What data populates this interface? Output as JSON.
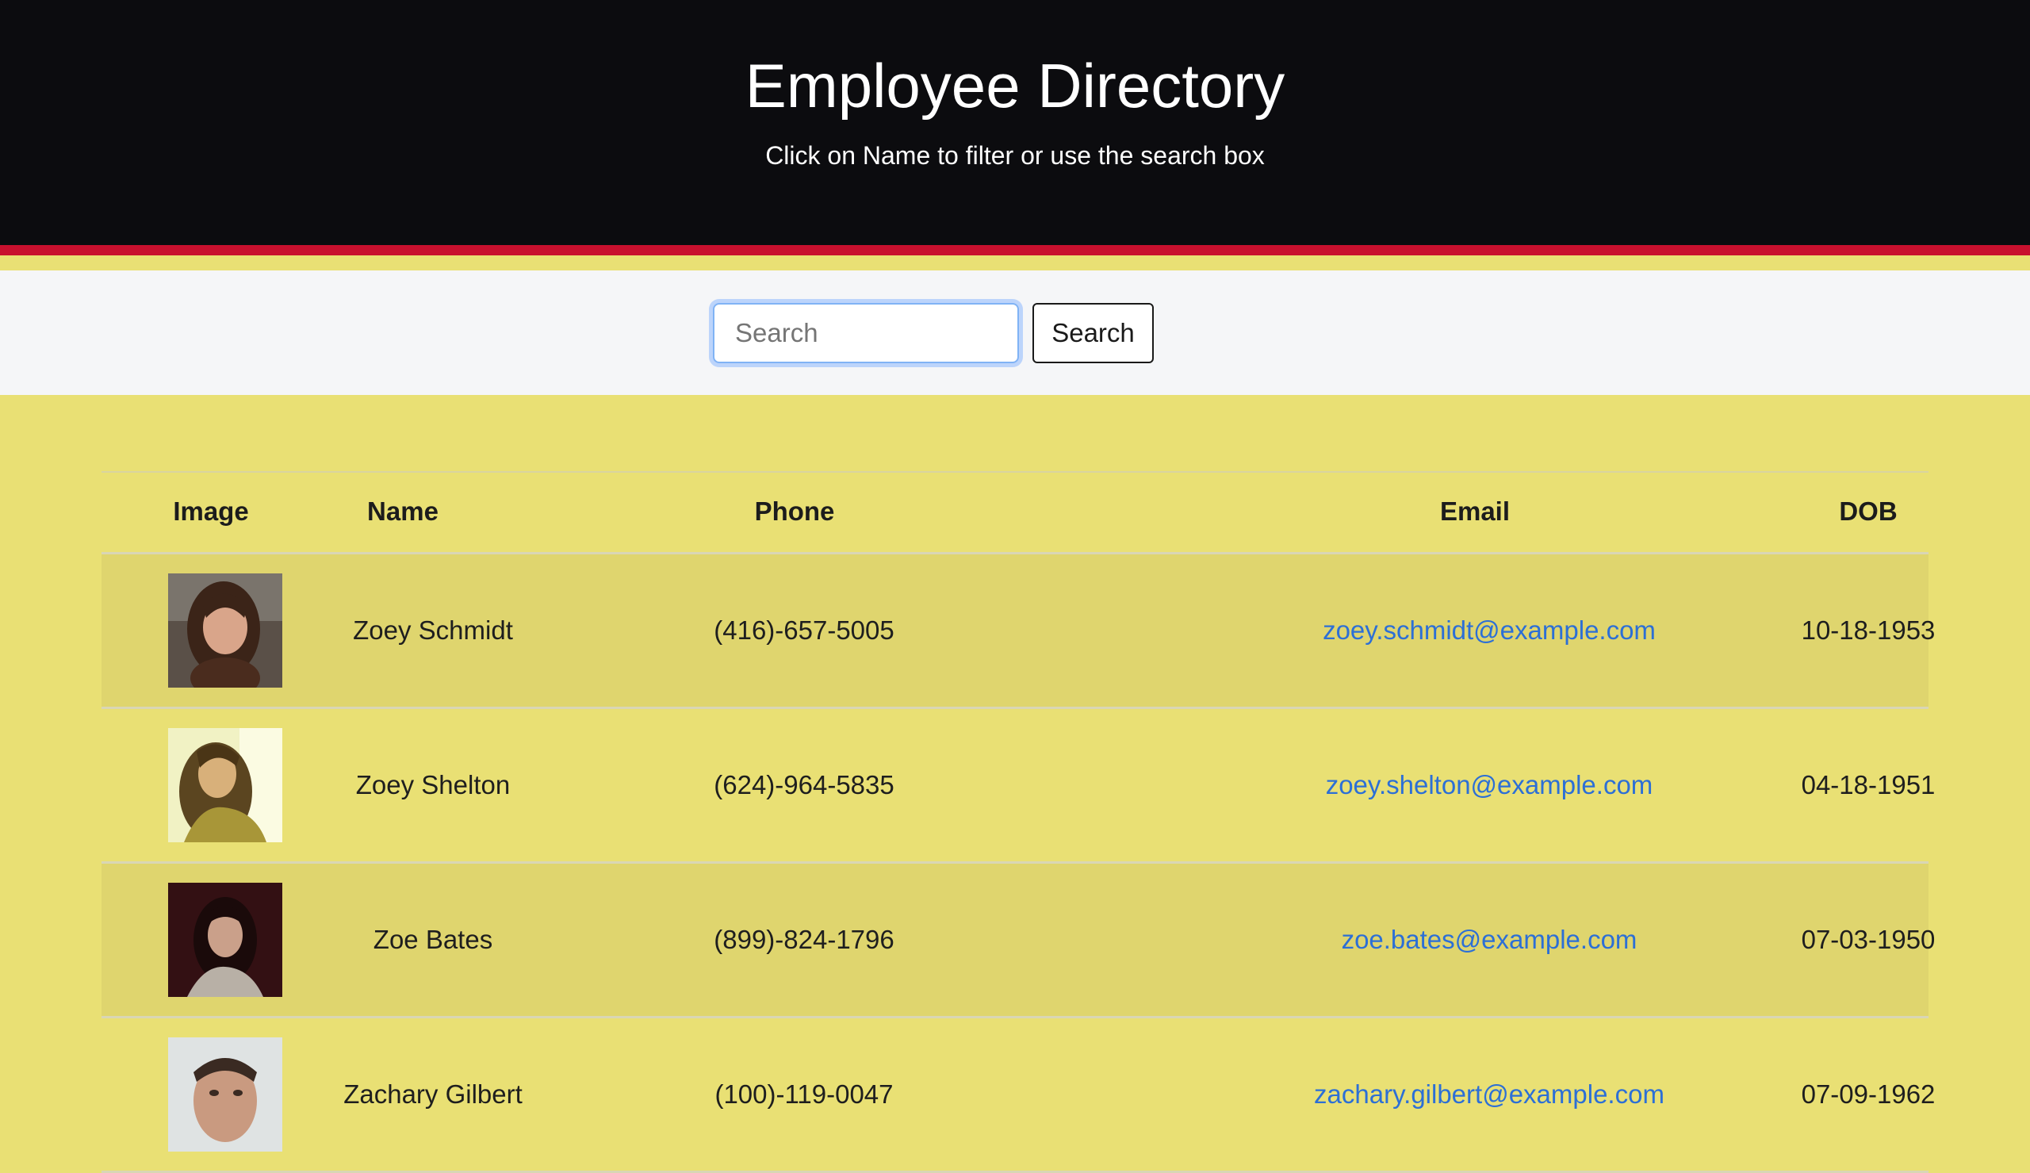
{
  "header": {
    "title": "Employee Directory",
    "subtitle": "Click on Name to filter or use the search box"
  },
  "search": {
    "placeholder": "Search",
    "value": "",
    "button_label": "Search"
  },
  "table": {
    "columns": [
      "Image",
      "Name",
      "Phone",
      "Email",
      "DOB"
    ],
    "rows": [
      {
        "name": "Zoey Schmidt",
        "phone": "(416)-657-5005",
        "email": "zoey.schmidt@example.com",
        "dob": "10-18-1953",
        "avatar": "woman-portrait"
      },
      {
        "name": "Zoey Shelton",
        "phone": "(624)-964-5835",
        "email": "zoey.shelton@example.com",
        "dob": "04-18-1951",
        "avatar": "woman-portrait"
      },
      {
        "name": "Zoe Bates",
        "phone": "(899)-824-1796",
        "email": "zoe.bates@example.com",
        "dob": "07-03-1950",
        "avatar": "woman-portrait"
      },
      {
        "name": "Zachary Gilbert",
        "phone": "(100)-119-0047",
        "email": "zachary.gilbert@example.com",
        "dob": "07-09-1962",
        "avatar": "man-portrait"
      }
    ]
  },
  "colors": {
    "header_bg": "#0c0c0f",
    "accent_red": "#c8102e",
    "page_bg": "#e9e074",
    "link": "#2c6fd6"
  }
}
